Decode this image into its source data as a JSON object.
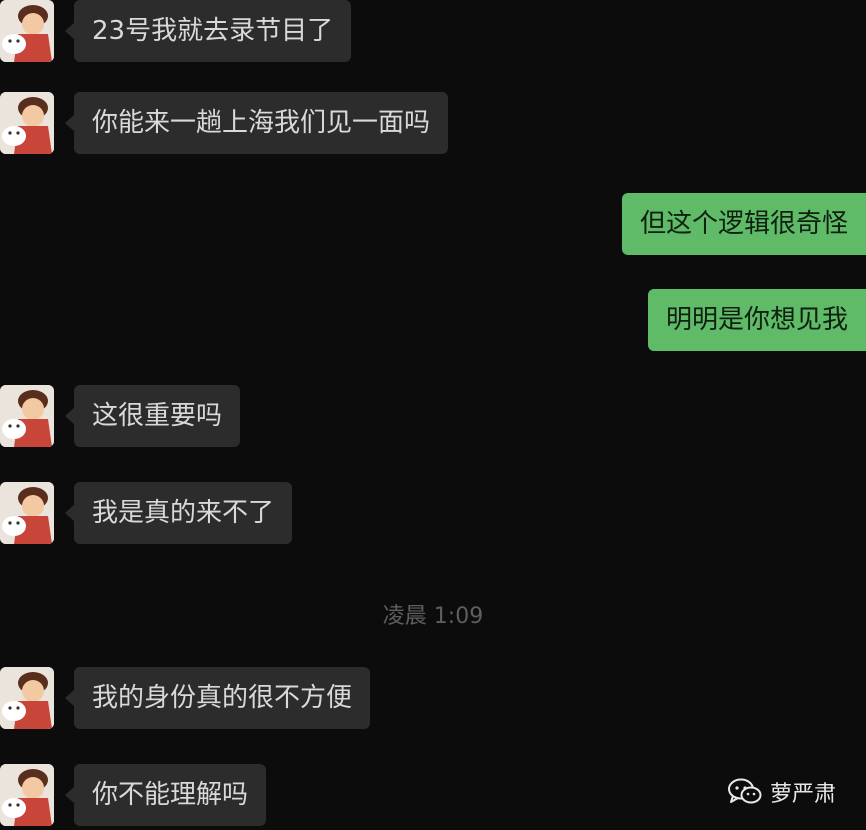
{
  "messages": [
    {
      "side": "left",
      "text": "23号我就去录节目了"
    },
    {
      "side": "left",
      "text": "你能来一趟上海我们见一面吗"
    },
    {
      "side": "right",
      "text": "但这个逻辑很奇怪"
    },
    {
      "side": "right",
      "text": "明明是你想见我"
    },
    {
      "side": "left",
      "text": "这很重要吗"
    },
    {
      "side": "left",
      "text": "我是真的来不了"
    },
    {
      "side": "left",
      "text": "我的身份真的很不方便"
    },
    {
      "side": "left",
      "text": "你不能理解吗"
    }
  ],
  "timestamp": "凌晨 1:09",
  "watermark": {
    "icon": "wechat-icon",
    "text": "萝严肃"
  },
  "colors": {
    "background": "#0c0c0c",
    "incoming_bubble": "#2c2c2c",
    "outgoing_bubble": "#5fbb67"
  }
}
